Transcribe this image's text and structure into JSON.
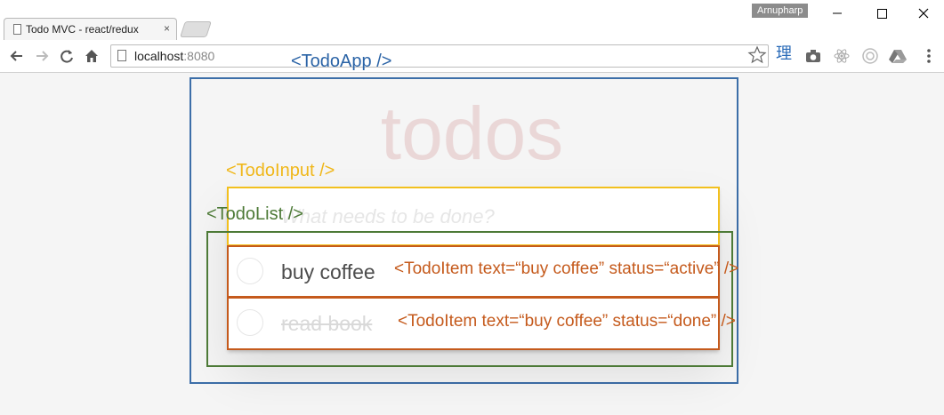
{
  "browser": {
    "tab_title": "Todo MVC - react/redux",
    "tab_close": "×",
    "user_name": "Arnupharp",
    "url_host": "localhost",
    "url_port": ":8080",
    "extension_char": "理"
  },
  "app": {
    "heading": "todos",
    "input_placeholder": "What needs to be done?",
    "todos": [
      {
        "text": "buy coffee",
        "completed": false
      },
      {
        "text": "read book",
        "completed": true
      }
    ]
  },
  "annotations": {
    "todo_app": "<TodoApp />",
    "todo_input": "<TodoInput />",
    "todo_list": "<TodoList />",
    "todo_item_1": "<TodoItem text=“buy coffee”  status=“active” />",
    "todo_item_2": "<TodoItem text=“buy coffee”  status=“done” />"
  },
  "colors": {
    "todo_app": "#3c6ea8",
    "todo_input": "#f2c01e",
    "todo_list": "#4d7a37",
    "todo_item": "#c55a1c",
    "heading": "rgba(175,47,47,0.15)"
  }
}
